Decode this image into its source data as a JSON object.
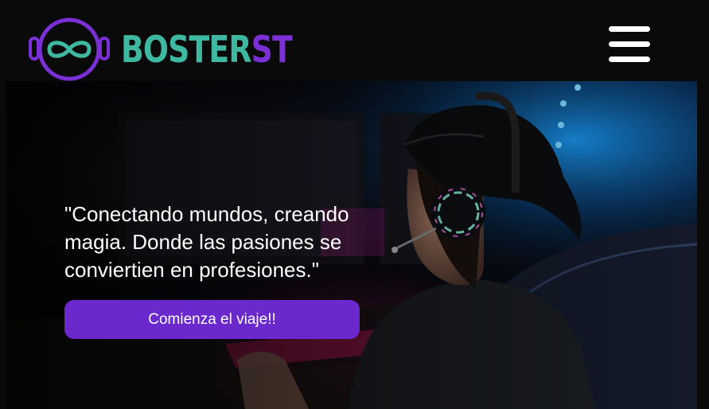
{
  "header": {
    "brand_part1": "BOSTER",
    "brand_part2": "ST",
    "brand_color_primary": "#3fb8a2",
    "brand_color_secondary": "#7b2fd6",
    "logo_icon": "infinity-astronaut-helmet-icon",
    "menu_icon": "hamburger-menu-icon"
  },
  "hero": {
    "background_image": "gamer-with-headset-photo",
    "quote": "\"Conectando mundos, creando magia. Donde las pasiones se conviertien en profesiones.\"",
    "cta_label": "Comienza el viaje!!",
    "cta_color": "#6a28cd"
  }
}
